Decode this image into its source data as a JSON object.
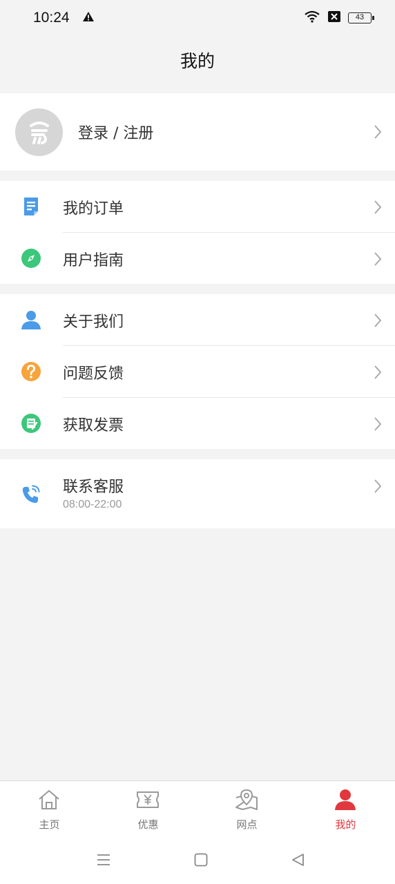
{
  "status": {
    "time": "10:24",
    "battery": "43"
  },
  "header": {
    "title": "我的"
  },
  "login": {
    "label": "登录 / 注册"
  },
  "menu_group1": [
    {
      "label": "我的订单",
      "icon": "order-icon"
    },
    {
      "label": "用户指南",
      "icon": "compass-icon"
    }
  ],
  "menu_group2": [
    {
      "label": "关于我们",
      "icon": "user-icon"
    },
    {
      "label": "问题反馈",
      "icon": "question-icon"
    },
    {
      "label": "获取发票",
      "icon": "invoice-icon"
    }
  ],
  "service": {
    "label": "联系客服",
    "hours": "08:00-22:00",
    "icon": "phone-icon"
  },
  "tabs": [
    {
      "label": "主页",
      "icon": "home-icon"
    },
    {
      "label": "优惠",
      "icon": "coupon-icon"
    },
    {
      "label": "网点",
      "icon": "map-pin-icon"
    },
    {
      "label": "我的",
      "icon": "profile-icon"
    }
  ],
  "colors": {
    "accent": "#e0383e",
    "blue": "#4a9be8",
    "green": "#3cc77b",
    "orange": "#f6a43b"
  }
}
